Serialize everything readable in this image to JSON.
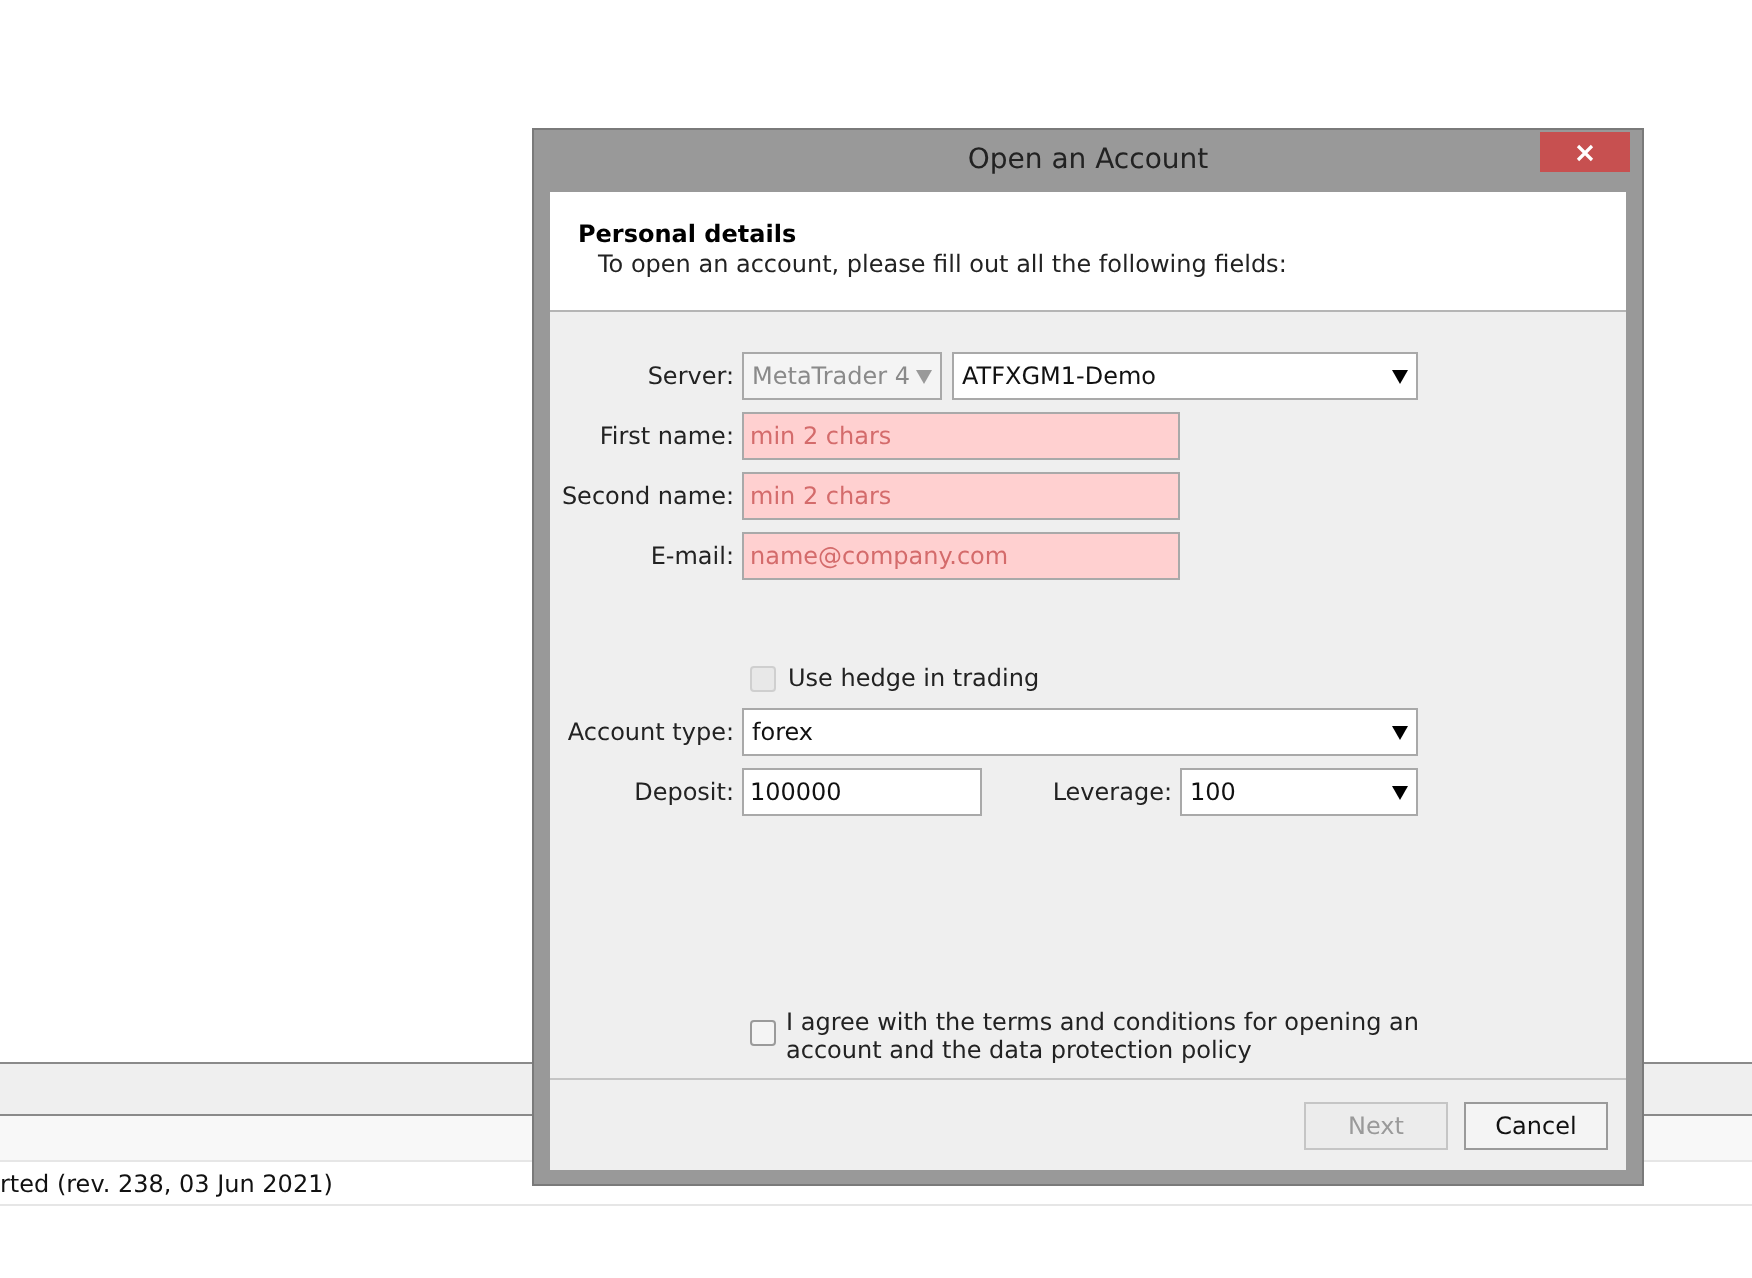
{
  "background": {
    "log_line": "rted (rev. 238, 03 Jun 2021)"
  },
  "dialog": {
    "title": "Open an Account",
    "header": {
      "title": "Personal details",
      "subtitle": "To open an account, please fill out all the following fields:"
    },
    "server": {
      "label": "Server:",
      "platform": {
        "value": "MetaTrader 4",
        "disabled": true
      },
      "server": {
        "value": "ATFXGM1-Demo",
        "disabled": false
      }
    },
    "fields": [
      {
        "label": "First name:",
        "placeholder": "min 2 chars",
        "invalid": true
      },
      {
        "label": "Second name:",
        "placeholder": "min 2 chars",
        "invalid": true
      },
      {
        "label": "E-mail:",
        "placeholder": "name@company.com",
        "invalid": true
      }
    ],
    "hedge": {
      "label": "Use hedge in trading",
      "checked": false,
      "disabled": true
    },
    "account_type": {
      "label": "Account type:",
      "value": "forex"
    },
    "deposit": {
      "label": "Deposit:",
      "value": "100000"
    },
    "leverage": {
      "label": "Leverage:",
      "value": "100"
    },
    "agree": {
      "label": "I agree with the terms and conditions for opening an account and the data protection policy",
      "checked": false,
      "disabled": false
    },
    "buttons": [
      {
        "label": "Next",
        "disabled": true
      },
      {
        "label": "Cancel",
        "disabled": false
      }
    ]
  }
}
